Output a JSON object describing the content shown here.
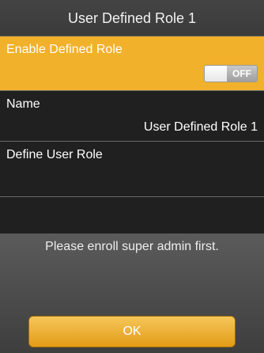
{
  "title": "User Defined Role 1",
  "menu": {
    "enable": {
      "label": "Enable Defined Role",
      "toggle_text": "OFF"
    },
    "name": {
      "label": "Name",
      "value": "User Defined Role 1"
    },
    "role": {
      "label": "Define User Role"
    }
  },
  "dialog": {
    "message": "Please enroll super admin first.",
    "ok_label": "OK"
  },
  "colors": {
    "accent": "#f2b12a",
    "background": "#202020"
  }
}
